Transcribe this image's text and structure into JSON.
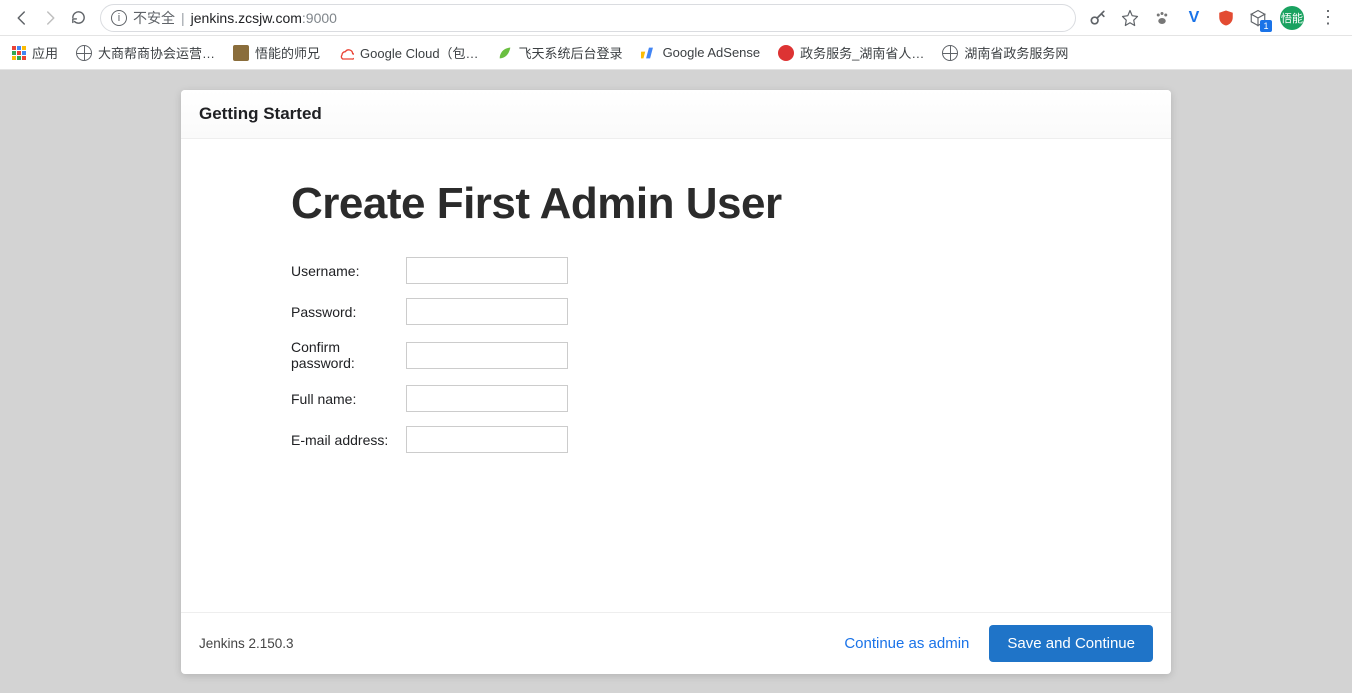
{
  "browser": {
    "url_insecure_label": "不安全",
    "url_host": "jenkins.zcsjw.com",
    "url_port": ":9000",
    "avatar_text": "悟能",
    "ext_badge": "1"
  },
  "bookmarks": {
    "apps_label": "应用",
    "items": [
      "大商帮商协会运营…",
      "悟能的师兄",
      "Google Cloud（包…",
      "飞天系统后台登录",
      "Google AdSense",
      "政务服务_湖南省人…",
      "湖南省政务服务网"
    ]
  },
  "page": {
    "header": "Getting Started",
    "title": "Create First Admin User",
    "labels": {
      "username": "Username:",
      "password": "Password:",
      "confirm": "Confirm password:",
      "fullname": "Full name:",
      "email": "E-mail address:"
    },
    "footer": {
      "version": "Jenkins 2.150.3",
      "continue_as_admin": "Continue as admin",
      "save": "Save and Continue"
    }
  }
}
